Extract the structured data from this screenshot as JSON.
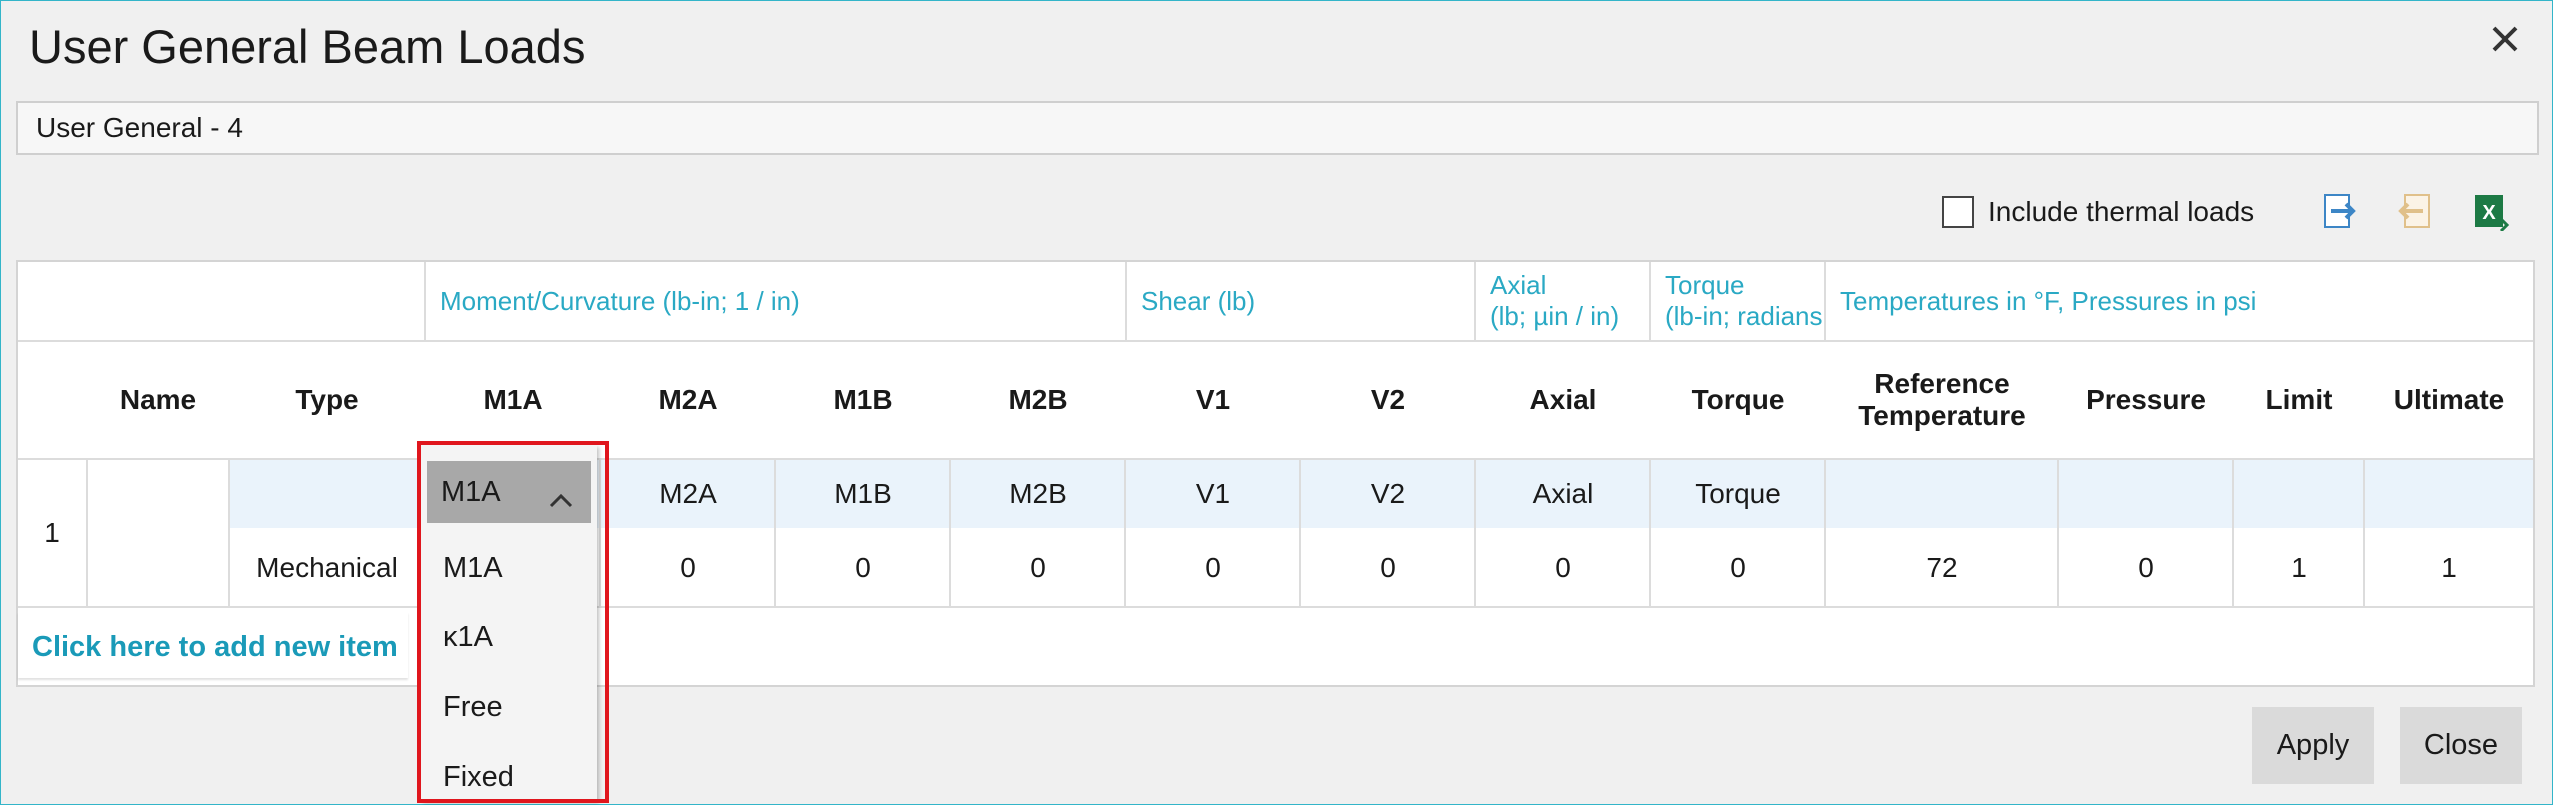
{
  "window": {
    "title": "User General Beam Loads",
    "load_name": "User General - 4"
  },
  "toolbar": {
    "include_thermal_label": "Include thermal loads",
    "include_thermal_checked": false,
    "export_icon": "export-arrow-icon",
    "import_icon": "import-arrow-icon",
    "excel_icon": "excel-icon"
  },
  "grid": {
    "groups": {
      "moment": "Moment/Curvature (lb-in; 1 / in)",
      "shear": "Shear (lb)",
      "axial_line1": "Axial",
      "axial_line2": "(lb; µin / in)",
      "torque_line1": "Torque",
      "torque_line2": "(lb-in; radians",
      "temps": "Temperatures in °F, Pressures in psi"
    },
    "columns": {
      "name": "Name",
      "type": "Type",
      "m1a": "M1A",
      "m2a": "M2A",
      "m1b": "M1B",
      "m2b": "M2B",
      "v1": "V1",
      "v2": "V2",
      "axial": "Axial",
      "torque": "Torque",
      "ref_temp_line1": "Reference",
      "ref_temp_line2": "Temperature",
      "pressure": "Pressure",
      "limit": "Limit",
      "ultimate": "Ultimate"
    },
    "row": {
      "index": "1",
      "name": "",
      "type": "Mechanical",
      "bc": {
        "m2a": "M2A",
        "m1b": "M1B",
        "m2b": "M2B",
        "v1": "V1",
        "v2": "V2",
        "axial": "Axial",
        "torque": "Torque"
      },
      "values": {
        "m2a": "0",
        "m1b": "0",
        "m2b": "0",
        "v1": "0",
        "v2": "0",
        "axial": "0",
        "torque": "0",
        "ref_temp": "72",
        "pressure": "0",
        "limit": "1",
        "ultimate": "1"
      }
    },
    "add_item_label": "Click here to add new item"
  },
  "dropdown": {
    "selected": "M1A",
    "options": [
      "M1A",
      "κ1A",
      "Free",
      "Fixed"
    ]
  },
  "buttons": {
    "apply": "Apply",
    "close": "Close"
  },
  "colors": {
    "accent": "#2aa9c4",
    "highlight": "#e0161d",
    "link": "#1a9ab8"
  }
}
